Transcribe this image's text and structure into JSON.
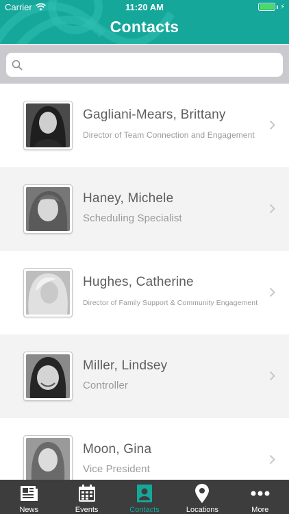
{
  "status_bar": {
    "carrier": "Carrier",
    "time": "11:20 AM",
    "battery_level": 1.0
  },
  "header": {
    "title": "Contacts"
  },
  "search": {
    "placeholder": "",
    "value": ""
  },
  "contacts": [
    {
      "name": "Gagliani-Mears, Brittany",
      "title": "Director of Team Connection and Engagement"
    },
    {
      "name": "Haney, Michele",
      "title": "Scheduling Specialist"
    },
    {
      "name": "Hughes, Catherine",
      "title": "Director of Family Support & Community Engagement"
    },
    {
      "name": "Miller, Lindsey",
      "title": "Controller"
    },
    {
      "name": "Moon, Gina",
      "title": "Vice President"
    }
  ],
  "tabs": [
    {
      "label": "News",
      "icon": "newspaper-icon"
    },
    {
      "label": "Events",
      "icon": "calendar-icon"
    },
    {
      "label": "Contacts",
      "icon": "contact-icon",
      "active": true
    },
    {
      "label": "Locations",
      "icon": "map-pin-icon"
    },
    {
      "label": "More",
      "icon": "more-icon"
    }
  ],
  "colors": {
    "brand": "#14a79a",
    "tabbar": "#3d3d3d",
    "row_alt": "#f3f3f3",
    "name_text": "#5e5e5e",
    "title_text": "#9a9a9a"
  }
}
